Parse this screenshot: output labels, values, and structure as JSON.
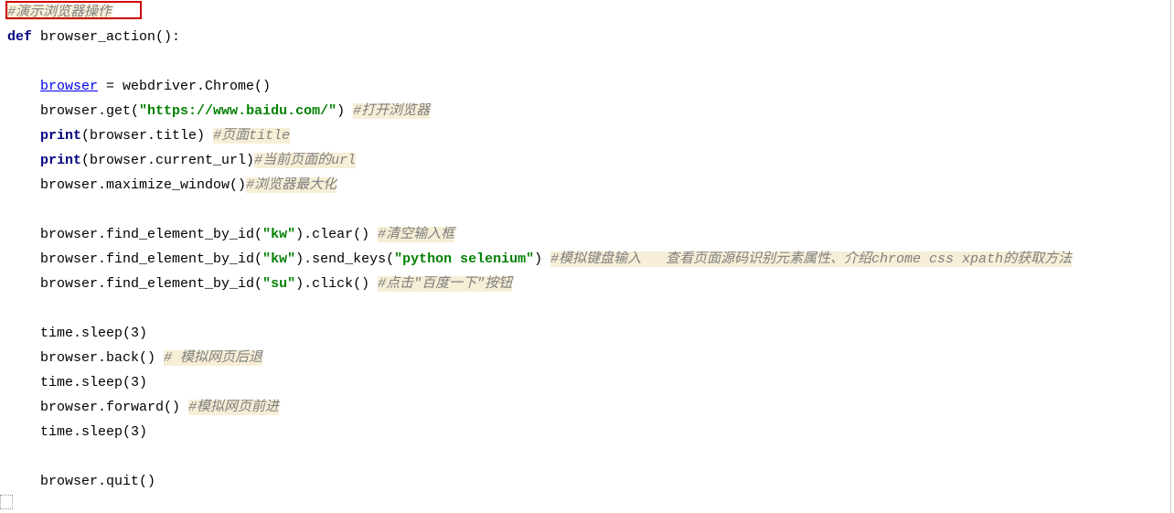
{
  "code": {
    "c_top": "#演示浏览器操作",
    "def_kw": "def",
    "def_name": " browser_action():",
    "browser_var": "browser",
    "eq_chrome": " = webdriver.Chrome()",
    "get_pre": "browser.get(",
    "url_str": "\"https://www.baidu.com/\"",
    "get_post": ") ",
    "c_open": "#打开浏览器",
    "print_kw": "print",
    "title_arg": "(browser.title) ",
    "c_title": "#页面title",
    "url_arg": "(browser.current_url)",
    "c_url": "#当前页面的url",
    "maxwin": "browser.maximize_window()",
    "c_maxwin": "#浏览器最大化",
    "find_kw_pre": "browser.find_element_by_id(",
    "kw_str": "\"kw\"",
    "clear_post": ").clear() ",
    "c_clear": "#清空输入框",
    "send_mid": ").send_keys(",
    "py_str": "\"python selenium\"",
    "send_post": ") ",
    "c_send": "#模拟键盘输入   查看页面源码识别元素属性、介绍chrome css xpath的获取方法",
    "su_str": "\"su\"",
    "click_post": ").click() ",
    "c_click": "#点击\"百度一下\"按钮",
    "sleep1": "time.sleep(3)",
    "back": "browser.back() ",
    "c_back": "# 模拟网页后退",
    "sleep2": "time.sleep(3)",
    "forward": "browser.forward() ",
    "c_fwd": "#模拟网页前进",
    "sleep3": "time.sleep(3)",
    "quit": "browser.quit()"
  }
}
